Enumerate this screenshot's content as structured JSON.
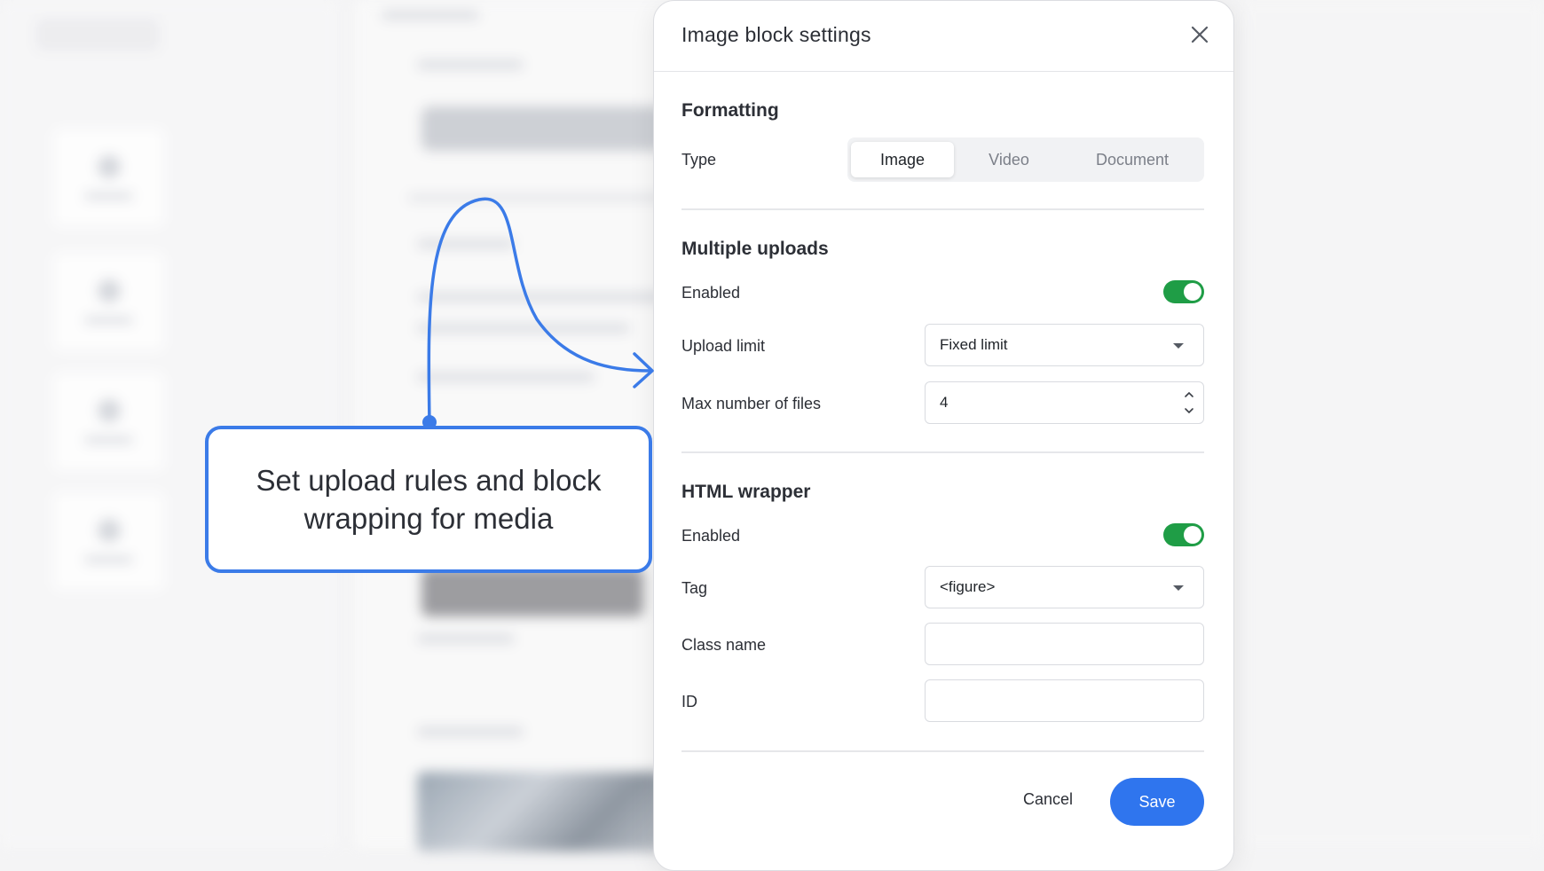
{
  "dialog": {
    "title": "Image block settings",
    "close_icon": "close-icon",
    "formatting": {
      "title": "Formatting",
      "type_label": "Type",
      "type_options": [
        "Image",
        "Video",
        "Document"
      ],
      "type_selected": "Image"
    },
    "multiple_uploads": {
      "title": "Multiple uploads",
      "enabled_label": "Enabled",
      "enabled": true,
      "upload_limit_label": "Upload limit",
      "upload_limit_value": "Fixed limit",
      "max_files_label": "Max number of files",
      "max_files_value": "4"
    },
    "html_wrapper": {
      "title": "HTML wrapper",
      "enabled_label": "Enabled",
      "enabled": true,
      "tag_label": "Tag",
      "tag_value": "<figure>",
      "class_label": "Class name",
      "class_value": "",
      "id_label": "ID",
      "id_value": ""
    },
    "cancel_label": "Cancel",
    "save_label": "Save"
  },
  "callout": {
    "text": "Set upload rules and block wrapping for media"
  },
  "colors": {
    "accent": "#2f75ee",
    "toggle_on": "#1f9d46",
    "callout_border": "#3b7be8"
  }
}
